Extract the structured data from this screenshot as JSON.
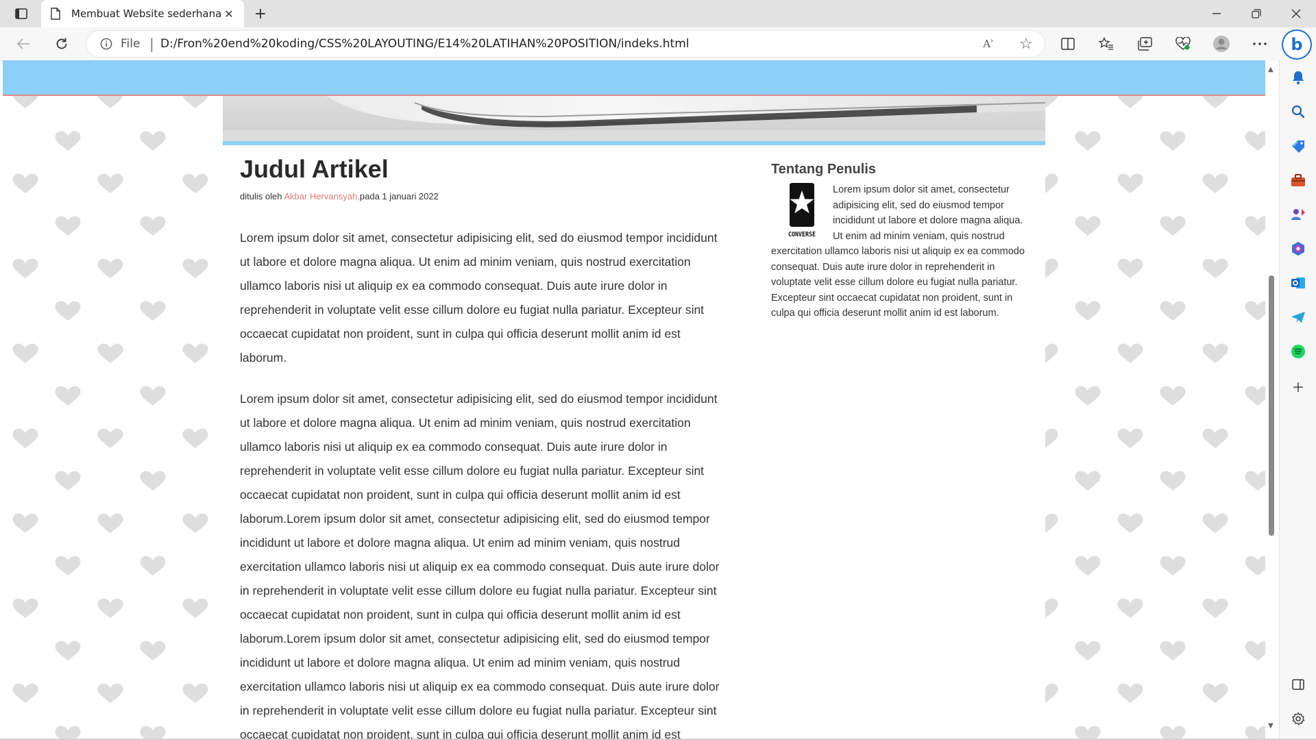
{
  "browser": {
    "tab_title": "Membuat Website sederhana",
    "address": {
      "scheme_label": "File",
      "separator": "|",
      "url": "D:/Fron%20end%20koding/CSS%20LAYOUTING/E14%20LATIHAN%20POSITION/indeks.html",
      "read_aloud_label": "Aʾ"
    },
    "accent_color": "#1f6fcf"
  },
  "page": {
    "header_color": "#8ccff7",
    "header_border_color": "#e4888c",
    "article": {
      "title": "Judul Artikel",
      "meta_prefix": "ditulis oleh ",
      "author": "Akbar Hervansyah,",
      "meta_suffix": "pada 1 januari 2022",
      "paragraphs": [
        "Lorem ipsum dolor sit amet, consectetur adipisicing elit, sed do eiusmod tempor incididunt ut labore et dolore magna aliqua. Ut enim ad minim veniam, quis nostrud exercitation ullamco laboris nisi ut aliquip ex ea commodo consequat. Duis aute irure dolor in reprehenderit in voluptate velit esse cillum dolore eu fugiat nulla pariatur. Excepteur sint occaecat cupidatat non proident, sunt in culpa qui officia deserunt mollit anim id est laborum.",
        "Lorem ipsum dolor sit amet, consectetur adipisicing elit, sed do eiusmod tempor incididunt ut labore et dolore magna aliqua. Ut enim ad minim veniam, quis nostrud exercitation ullamco laboris nisi ut aliquip ex ea commodo consequat. Duis aute irure dolor in reprehenderit in voluptate velit esse cillum dolore eu fugiat nulla pariatur. Excepteur sint occaecat cupidatat non proident, sunt in culpa qui officia deserunt mollit anim id est laborum.Lorem ipsum dolor sit amet, consectetur adipisicing elit, sed do eiusmod tempor incididunt ut labore et dolore magna aliqua. Ut enim ad minim veniam, quis nostrud exercitation ullamco laboris nisi ut aliquip ex ea commodo consequat. Duis aute irure dolor in reprehenderit in voluptate velit esse cillum dolore eu fugiat nulla pariatur. Excepteur sint occaecat cupidatat non proident, sunt in culpa qui officia deserunt mollit anim id est laborum.Lorem ipsum dolor sit amet, consectetur adipisicing elit, sed do eiusmod tempor incididunt ut labore et dolore magna aliqua. Ut enim ad minim veniam, quis nostrud exercitation ullamco laboris nisi ut aliquip ex ea commodo consequat. Duis aute irure dolor in reprehenderit in voluptate velit esse cillum dolore eu fugiat nulla pariatur. Excepteur sint occaecat cupidatat non proident, sunt in culpa qui officia deserunt mollit anim id est laborum."
      ]
    },
    "sidebar": {
      "title": "Tentang Penulis",
      "logo_text": "CONVERSE",
      "body": "Lorem ipsum dolor sit amet, consectetur adipisicing elit, sed do eiusmod tempor incididunt ut labore et dolore magna aliqua. Ut enim ad minim veniam, quis nostrud exercitation ullamco laboris nisi ut aliquip ex ea commodo consequat. Duis aute irure dolor in reprehenderit in voluptate velit esse cillum dolore eu fugiat nulla pariatur. Excepteur sint occaecat cupidatat non proident, sunt in culpa qui officia deserunt mollit anim id est laborum."
    }
  },
  "icons": {
    "tab_actions": "tab-actions-icon",
    "tab_page": "page-icon",
    "new_tab": "plus-icon",
    "back": "back-arrow-icon",
    "reload": "reload-icon",
    "info": "info-icon",
    "favorite": "star-icon",
    "split_screen": "split-screen-icon",
    "favorites": "favorites-icon",
    "collections": "collections-icon",
    "browser_essentials": "heartbeat-icon",
    "profile": "profile-icon",
    "more": "more-icon",
    "bing": "bing-icon",
    "sidebar": [
      "bell-icon",
      "search-icon",
      "shopping-tag-icon",
      "toolbox-icon",
      "games-icon",
      "microsoft-365-icon",
      "outlook-icon",
      "telegram-icon",
      "spotify-icon",
      "add-icon",
      "sidebar-toggle-icon",
      "settings-icon"
    ]
  }
}
